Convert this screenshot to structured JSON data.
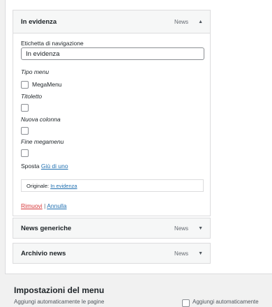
{
  "menu_items": [
    {
      "title": "In evidenza",
      "type": "News",
      "expanded": true,
      "arrow": "▲",
      "nav_label_caption": "Etichetta di navigazione",
      "nav_label_value": "In evidenza",
      "menu_type_caption": "Tipo menu",
      "megamenu_label": "MegaMenu",
      "subtitle_caption": "Titoletto",
      "new_column_caption": "Nuova colonna",
      "end_megamenu_caption": "Fine megamenu",
      "move_label": "Sposta",
      "move_link": "Giù di uno",
      "original_label": "Originale:",
      "original_link": "In evidenza",
      "remove_link": "Rimuovi",
      "separator": "|",
      "cancel_link": "Annulla"
    },
    {
      "title": "News generiche",
      "type": "News",
      "expanded": false,
      "arrow": "▼"
    },
    {
      "title": "Archivio news",
      "type": "News",
      "expanded": false,
      "arrow": "▼"
    }
  ],
  "menu_settings": {
    "heading": "Impostazioni del menu",
    "auto_add_label": "Aggiungi automaticamente le pagine",
    "auto_add_checkbox_label": "Aggiungi automaticamente"
  },
  "colors": {
    "link": "#2271b1",
    "danger": "#d63638",
    "border": "#dcdcde"
  }
}
